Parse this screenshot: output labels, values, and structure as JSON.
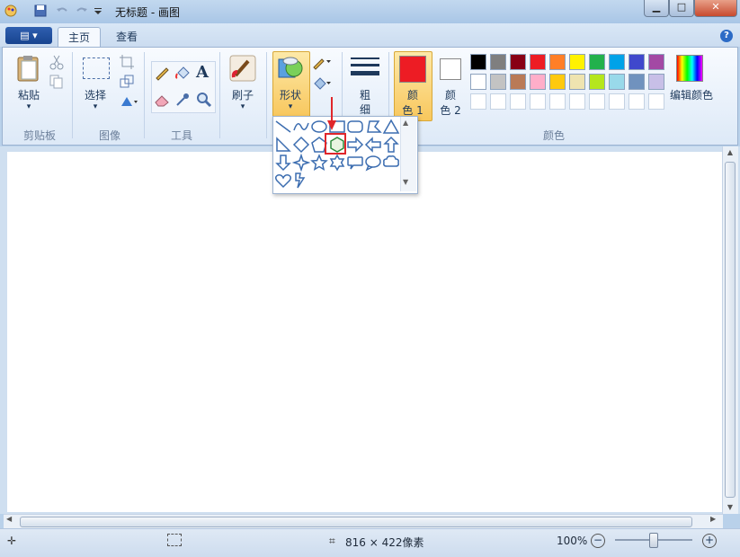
{
  "titlebar": {
    "title": "无标题 - 画图",
    "minimize_icon": "minimize-icon",
    "maximize_icon": "maximize-icon",
    "close_icon": "close-icon"
  },
  "tabs": [
    {
      "label": "主页",
      "active": true
    },
    {
      "label": "查看",
      "active": false
    }
  ],
  "ribbon": {
    "clipboard": {
      "group_label": "剪贴板",
      "paste_label": "粘贴"
    },
    "image": {
      "group_label": "图像",
      "select_label": "选择"
    },
    "tools": {
      "group_label": "工具"
    },
    "brushes_label": "刷子",
    "shapes_label": "形状",
    "size": {
      "label_line1": "粗",
      "label_line2": "细"
    },
    "color1": {
      "label_line1": "颜",
      "label_line2": "色 1",
      "color": "#ed1c24"
    },
    "color2": {
      "label_line1": "颜",
      "label_line2": "色 2",
      "color": "#ffffff"
    },
    "colors": {
      "group_label": "颜色",
      "edit_label": "编辑颜色"
    },
    "palette_row1": [
      "#000000",
      "#7f7f7f",
      "#880015",
      "#ed1c24",
      "#ff7f27",
      "#fff200",
      "#22b14c",
      "#00a2e8",
      "#3f48cc",
      "#a349a4"
    ],
    "palette_row2": [
      "#ffffff",
      "#c3c3c3",
      "#b97a57",
      "#ffaec9",
      "#ffc90e",
      "#efe4b0",
      "#b5e61d",
      "#99d9ea",
      "#7092be",
      "#c8bfe7"
    ]
  },
  "shapes_menu": {
    "items": [
      "line",
      "curve",
      "oval",
      "rectangle",
      "rounded-rectangle",
      "polygon",
      "triangle",
      "right-triangle",
      "diamond",
      "pentagon",
      "hexagon",
      "right-arrow",
      "left-arrow",
      "up-arrow",
      "down-arrow",
      "four-point-star",
      "five-point-star",
      "six-point-star",
      "rounded-callout",
      "oval-callout",
      "cloud-callout",
      "heart",
      "lightning"
    ],
    "selected": "hexagon",
    "accent_color": "#e0262b"
  },
  "statusbar": {
    "canvas_size": "816 × 422像素",
    "zoom": "100%",
    "zoom_out_label": "−",
    "zoom_in_label": "+"
  }
}
